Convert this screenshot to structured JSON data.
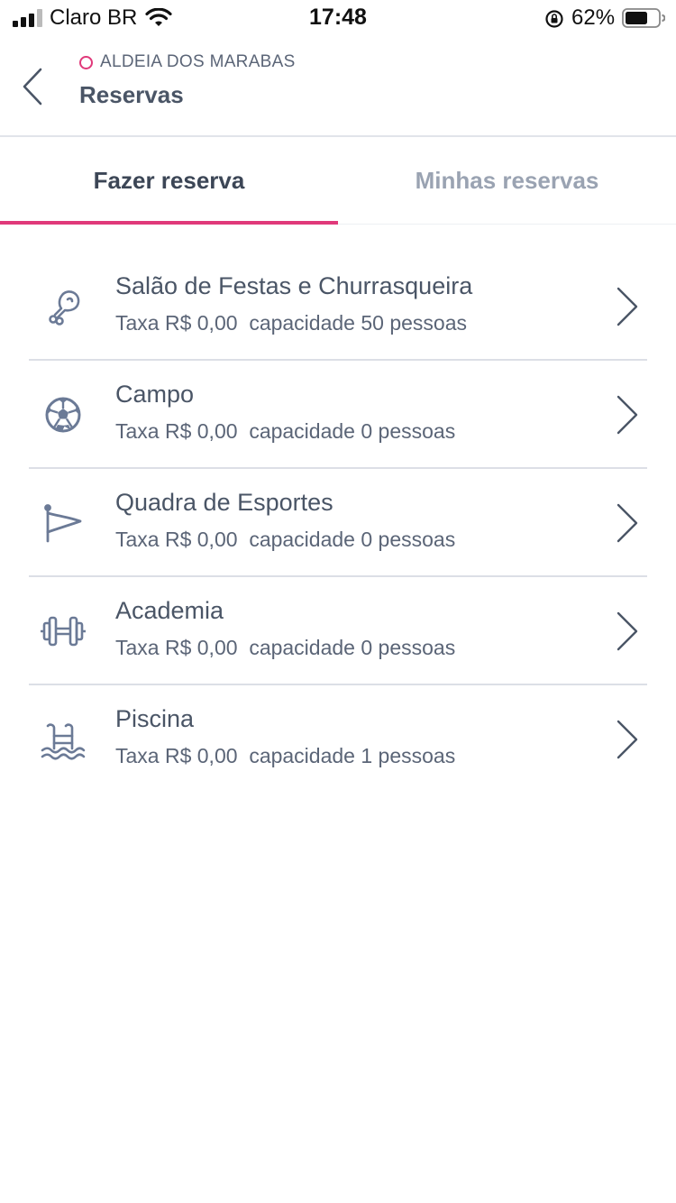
{
  "status_bar": {
    "carrier": "Claro BR",
    "time": "17:48",
    "battery_percent": "62%"
  },
  "header": {
    "subtitle": "ALDEIA DOS MARABAS",
    "title": "Reservas"
  },
  "tabs": [
    {
      "label": "Fazer reserva",
      "active": true
    },
    {
      "label": "Minhas reservas",
      "active": false
    }
  ],
  "items": [
    {
      "icon": "chicken-leg-icon",
      "title": "Salão de Festas e Churrasqueira",
      "fee": "Taxa R$ 0,00",
      "capacity": "capacidade 50 pessoas"
    },
    {
      "icon": "soccer-ball-icon",
      "title": "Campo",
      "fee": "Taxa R$ 0,00",
      "capacity": "capacidade 0 pessoas"
    },
    {
      "icon": "pennant-flag-icon",
      "title": "Quadra de Esportes",
      "fee": "Taxa R$ 0,00",
      "capacity": "capacidade 0 pessoas"
    },
    {
      "icon": "dumbbell-icon",
      "title": "Academia",
      "fee": "Taxa R$ 0,00",
      "capacity": "capacidade 0 pessoas"
    },
    {
      "icon": "pool-ladder-icon",
      "title": "Piscina",
      "fee": "Taxa R$ 0,00",
      "capacity": "capacidade 1 pessoas"
    }
  ],
  "colors": {
    "accent": "#e0397a",
    "text": "#4a5566",
    "icon": "#6b7a96"
  }
}
